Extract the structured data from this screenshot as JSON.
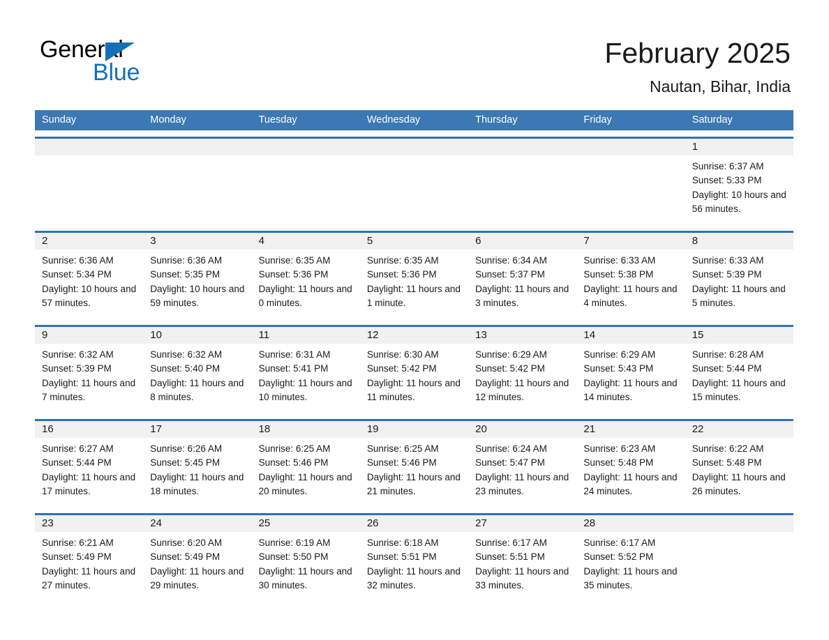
{
  "brand": {
    "word1": "General",
    "word2": "Blue",
    "triangle_color": "#1270b8"
  },
  "header": {
    "title": "February 2025",
    "subtitle": "Nautan, Bihar, India",
    "header_bg": "#3b78b4",
    "row_accent": "#2e74b5",
    "datenum_bg": "#f1f1f1"
  },
  "calendar": {
    "weekday_headers": [
      "Sunday",
      "Monday",
      "Tuesday",
      "Wednesday",
      "Thursday",
      "Friday",
      "Saturday"
    ],
    "weeks": [
      [
        {
          "day": "",
          "empty": true
        },
        {
          "day": "",
          "empty": true
        },
        {
          "day": "",
          "empty": true
        },
        {
          "day": "",
          "empty": true
        },
        {
          "day": "",
          "empty": true
        },
        {
          "day": "",
          "empty": true
        },
        {
          "day": "1",
          "sunrise": "Sunrise: 6:37 AM",
          "sunset": "Sunset: 5:33 PM",
          "daylight": "Daylight: 10 hours and 56 minutes."
        }
      ],
      [
        {
          "day": "2",
          "sunrise": "Sunrise: 6:36 AM",
          "sunset": "Sunset: 5:34 PM",
          "daylight": "Daylight: 10 hours and 57 minutes."
        },
        {
          "day": "3",
          "sunrise": "Sunrise: 6:36 AM",
          "sunset": "Sunset: 5:35 PM",
          "daylight": "Daylight: 10 hours and 59 minutes."
        },
        {
          "day": "4",
          "sunrise": "Sunrise: 6:35 AM",
          "sunset": "Sunset: 5:36 PM",
          "daylight": "Daylight: 11 hours and 0 minutes."
        },
        {
          "day": "5",
          "sunrise": "Sunrise: 6:35 AM",
          "sunset": "Sunset: 5:36 PM",
          "daylight": "Daylight: 11 hours and 1 minute."
        },
        {
          "day": "6",
          "sunrise": "Sunrise: 6:34 AM",
          "sunset": "Sunset: 5:37 PM",
          "daylight": "Daylight: 11 hours and 3 minutes."
        },
        {
          "day": "7",
          "sunrise": "Sunrise: 6:33 AM",
          "sunset": "Sunset: 5:38 PM",
          "daylight": "Daylight: 11 hours and 4 minutes."
        },
        {
          "day": "8",
          "sunrise": "Sunrise: 6:33 AM",
          "sunset": "Sunset: 5:39 PM",
          "daylight": "Daylight: 11 hours and 5 minutes."
        }
      ],
      [
        {
          "day": "9",
          "sunrise": "Sunrise: 6:32 AM",
          "sunset": "Sunset: 5:39 PM",
          "daylight": "Daylight: 11 hours and 7 minutes."
        },
        {
          "day": "10",
          "sunrise": "Sunrise: 6:32 AM",
          "sunset": "Sunset: 5:40 PM",
          "daylight": "Daylight: 11 hours and 8 minutes."
        },
        {
          "day": "11",
          "sunrise": "Sunrise: 6:31 AM",
          "sunset": "Sunset: 5:41 PM",
          "daylight": "Daylight: 11 hours and 10 minutes."
        },
        {
          "day": "12",
          "sunrise": "Sunrise: 6:30 AM",
          "sunset": "Sunset: 5:42 PM",
          "daylight": "Daylight: 11 hours and 11 minutes."
        },
        {
          "day": "13",
          "sunrise": "Sunrise: 6:29 AM",
          "sunset": "Sunset: 5:42 PM",
          "daylight": "Daylight: 11 hours and 12 minutes."
        },
        {
          "day": "14",
          "sunrise": "Sunrise: 6:29 AM",
          "sunset": "Sunset: 5:43 PM",
          "daylight": "Daylight: 11 hours and 14 minutes."
        },
        {
          "day": "15",
          "sunrise": "Sunrise: 6:28 AM",
          "sunset": "Sunset: 5:44 PM",
          "daylight": "Daylight: 11 hours and 15 minutes."
        }
      ],
      [
        {
          "day": "16",
          "sunrise": "Sunrise: 6:27 AM",
          "sunset": "Sunset: 5:44 PM",
          "daylight": "Daylight: 11 hours and 17 minutes."
        },
        {
          "day": "17",
          "sunrise": "Sunrise: 6:26 AM",
          "sunset": "Sunset: 5:45 PM",
          "daylight": "Daylight: 11 hours and 18 minutes."
        },
        {
          "day": "18",
          "sunrise": "Sunrise: 6:25 AM",
          "sunset": "Sunset: 5:46 PM",
          "daylight": "Daylight: 11 hours and 20 minutes."
        },
        {
          "day": "19",
          "sunrise": "Sunrise: 6:25 AM",
          "sunset": "Sunset: 5:46 PM",
          "daylight": "Daylight: 11 hours and 21 minutes."
        },
        {
          "day": "20",
          "sunrise": "Sunrise: 6:24 AM",
          "sunset": "Sunset: 5:47 PM",
          "daylight": "Daylight: 11 hours and 23 minutes."
        },
        {
          "day": "21",
          "sunrise": "Sunrise: 6:23 AM",
          "sunset": "Sunset: 5:48 PM",
          "daylight": "Daylight: 11 hours and 24 minutes."
        },
        {
          "day": "22",
          "sunrise": "Sunrise: 6:22 AM",
          "sunset": "Sunset: 5:48 PM",
          "daylight": "Daylight: 11 hours and 26 minutes."
        }
      ],
      [
        {
          "day": "23",
          "sunrise": "Sunrise: 6:21 AM",
          "sunset": "Sunset: 5:49 PM",
          "daylight": "Daylight: 11 hours and 27 minutes."
        },
        {
          "day": "24",
          "sunrise": "Sunrise: 6:20 AM",
          "sunset": "Sunset: 5:49 PM",
          "daylight": "Daylight: 11 hours and 29 minutes."
        },
        {
          "day": "25",
          "sunrise": "Sunrise: 6:19 AM",
          "sunset": "Sunset: 5:50 PM",
          "daylight": "Daylight: 11 hours and 30 minutes."
        },
        {
          "day": "26",
          "sunrise": "Sunrise: 6:18 AM",
          "sunset": "Sunset: 5:51 PM",
          "daylight": "Daylight: 11 hours and 32 minutes."
        },
        {
          "day": "27",
          "sunrise": "Sunrise: 6:17 AM",
          "sunset": "Sunset: 5:51 PM",
          "daylight": "Daylight: 11 hours and 33 minutes."
        },
        {
          "day": "28",
          "sunrise": "Sunrise: 6:17 AM",
          "sunset": "Sunset: 5:52 PM",
          "daylight": "Daylight: 11 hours and 35 minutes."
        },
        {
          "day": "",
          "empty": true,
          "trailing": true
        }
      ]
    ]
  }
}
